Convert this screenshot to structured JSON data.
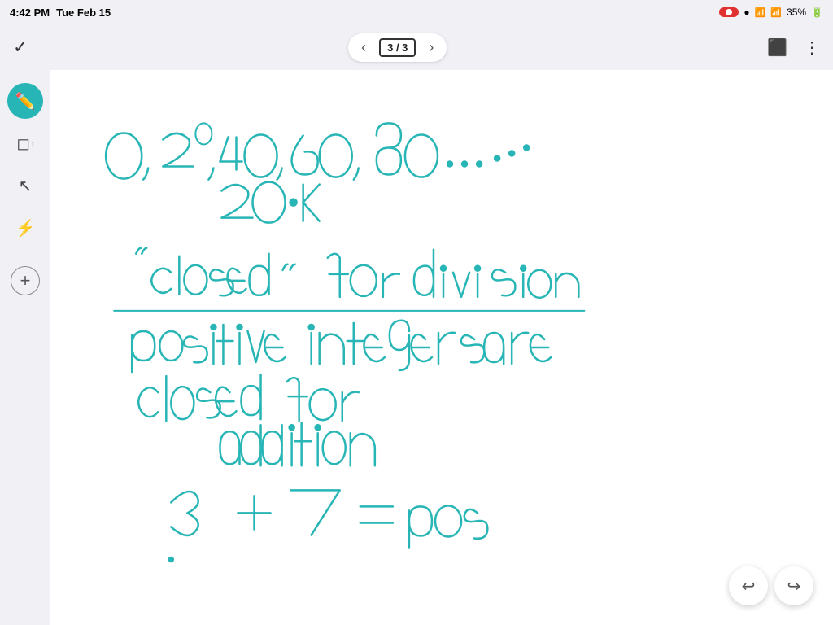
{
  "statusBar": {
    "time": "4:42 PM",
    "date": "Tue Feb 15",
    "recordLabel": "●",
    "battery": "35%",
    "wifiIcon": "wifi",
    "signalIcon": "signal",
    "cellIcon": "G"
  },
  "navBar": {
    "checkLabel": "✓",
    "prevArrow": "‹",
    "nextArrow": "›",
    "pageLabel": "3 / 3",
    "castIcon": "⬜",
    "moreIcon": "⋮"
  },
  "toolbar": {
    "penLabel": "✏",
    "eraserLabel": "⬜",
    "selectLabel": "↖",
    "highlighterLabel": "⚡",
    "addLabel": "+"
  },
  "undoRedo": {
    "undoLabel": "↩",
    "redoLabel": "↪"
  },
  "canvas": {
    "content": "handwritten math notes"
  }
}
